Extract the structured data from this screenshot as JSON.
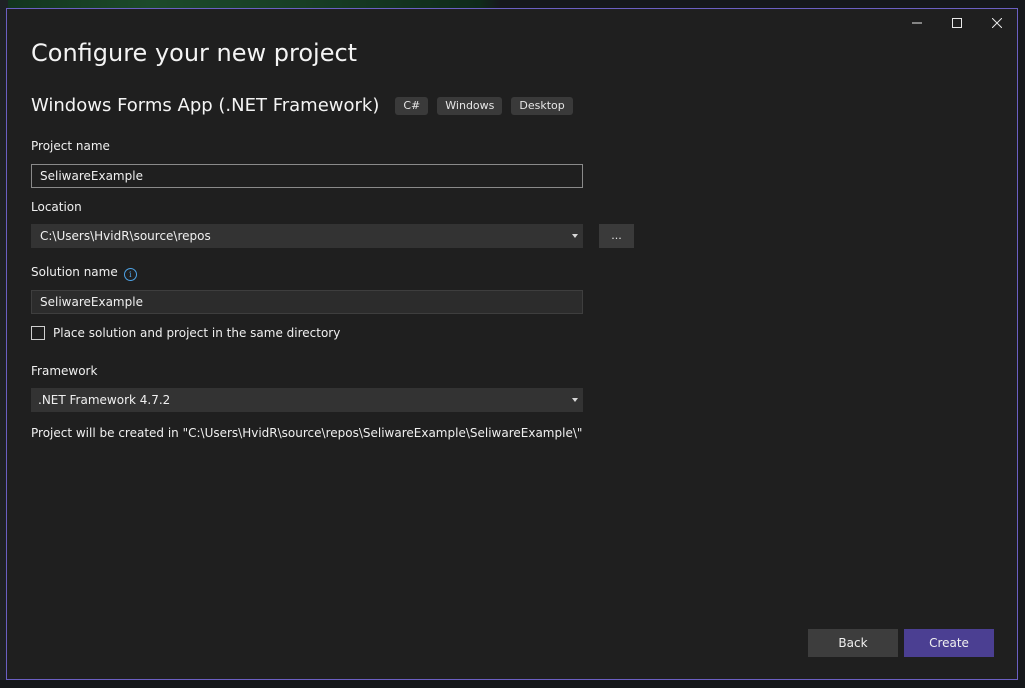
{
  "dialog": {
    "title": "Configure your new project",
    "template_name": "Windows Forms App (.NET Framework)",
    "tags": [
      "C#",
      "Windows",
      "Desktop"
    ]
  },
  "window_controls": {
    "minimize": "—",
    "maximize": "☐",
    "close": "✕"
  },
  "project_name": {
    "label": "Project name",
    "value": "SeliwareExample"
  },
  "location": {
    "label": "Location",
    "value": "C:\\Users\\HvidR\\source\\repos",
    "browse_label": "..."
  },
  "solution_name": {
    "label": "Solution name",
    "value": "SeliwareExample",
    "info_glyph": "i"
  },
  "same_directory": {
    "label": "Place solution and project in the same directory",
    "checked": false
  },
  "framework": {
    "label": "Framework",
    "value": ".NET Framework 4.7.2"
  },
  "path_note": "Project will be created in \"C:\\Users\\HvidR\\source\\repos\\SeliwareExample\\SeliwareExample\\\"",
  "footer": {
    "back_label": "Back",
    "create_label": "Create"
  },
  "colors": {
    "accent": "#4b3f92",
    "border": "#6b5fc2",
    "background": "#1f1f1f"
  }
}
